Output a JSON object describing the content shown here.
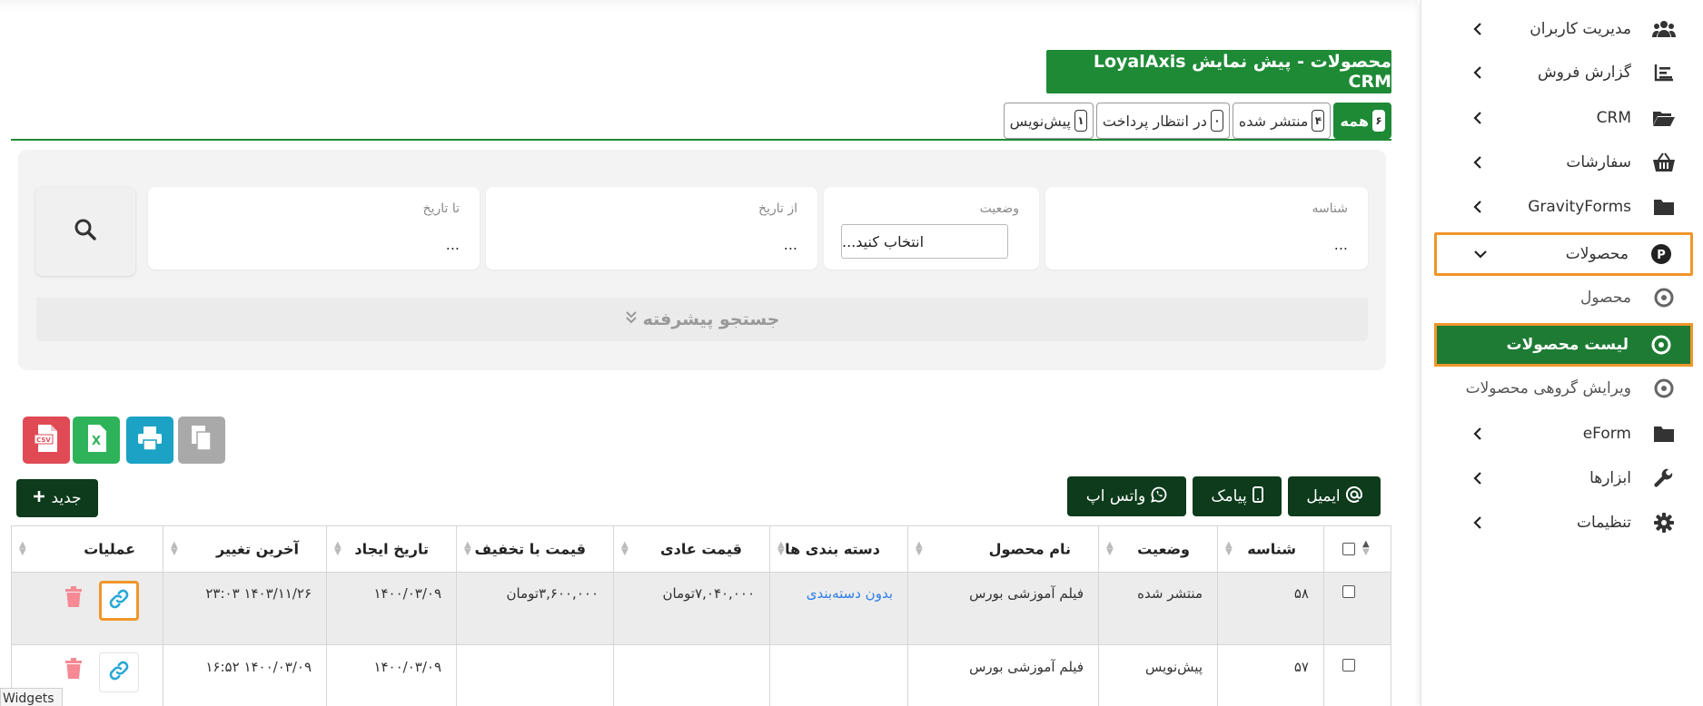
{
  "sidebar": {
    "items": [
      {
        "label": "مدیریت کاربران",
        "icon": "users-icon"
      },
      {
        "label": "گزارش فروش",
        "icon": "bar-chart-icon"
      },
      {
        "label": "CRM",
        "icon": "folder-open-icon"
      },
      {
        "label": "سفارشات",
        "icon": "basket-icon"
      },
      {
        "label": "GravityForms",
        "icon": "folder-icon"
      },
      {
        "label": "محصولات",
        "icon": "product-p-icon"
      },
      {
        "label": "محصول",
        "icon": "circle-dot-icon"
      },
      {
        "label": "لیست محصولات",
        "icon": "circle-dot-icon"
      },
      {
        "label": "ویرایش گروهی محصولات",
        "icon": "circle-dot-icon"
      },
      {
        "label": "eForm",
        "icon": "folder-icon"
      },
      {
        "label": "ابزارها",
        "icon": "wrench-icon"
      },
      {
        "label": "تنظیمات",
        "icon": "gear-icon"
      }
    ]
  },
  "header": {
    "title": "محصولات - پیش نمایش LoyalAxis CRM"
  },
  "tabs": [
    {
      "label": "همه",
      "count": "۶"
    },
    {
      "label": "منتشر شده",
      "count": "۴"
    },
    {
      "label": "در انتظار پرداخت",
      "count": "۰"
    },
    {
      "label": "پیش‌نویس",
      "count": "۱"
    }
  ],
  "filters": {
    "id": {
      "label": "شناسه",
      "value": "..."
    },
    "status": {
      "label": "وضعیت",
      "value": "انتخاب کنید..."
    },
    "from_date": {
      "label": "از تاریخ",
      "value": "..."
    },
    "to_date": {
      "label": "تا تاریخ",
      "value": "..."
    },
    "advanced": "جستجو پیشرفته"
  },
  "actions": {
    "new": "جدید",
    "email": "ایمیل",
    "sms": "پیامک",
    "whatsapp": "واتس اپ"
  },
  "colors": {
    "brand_green": "#1e8a36",
    "dark_green": "#0d3b1c",
    "highlight_orange": "#f0962b",
    "link_blue": "#2b7de9",
    "delete_red": "#f58a94"
  },
  "table": {
    "columns": [
      "شناسه",
      "وضعیت",
      "نام محصول",
      "دسته بندی ها",
      "قیمت عادی",
      "قیمت با تخفیف",
      "تاریخ ایجاد",
      "آخرین تغییر",
      "عملیات"
    ],
    "rows": [
      {
        "id": "۵۸",
        "status": "منتشر شده",
        "name": "فیلم آموزشی بورس",
        "category": "بدون دسته‌بندی",
        "regular_price": "۷,۰۴۰,۰۰۰تومان",
        "sale_price": "۳,۶۰۰,۰۰۰تومان",
        "created": "۱۴۰۰/۰۳/۰۹",
        "modified": "۱۴۰۳/۱۱/۲۶ ۲۳:۰۳"
      },
      {
        "id": "۵۷",
        "status": "پیش‌نویس",
        "name": "فیلم آموزشی بورس",
        "category": "",
        "regular_price": "",
        "sale_price": "",
        "created": "۱۴۰۰/۰۳/۰۹",
        "modified": "۱۴۰۰/۰۳/۰۹ ۱۶:۵۲"
      }
    ]
  },
  "tooltip": "Widgets"
}
